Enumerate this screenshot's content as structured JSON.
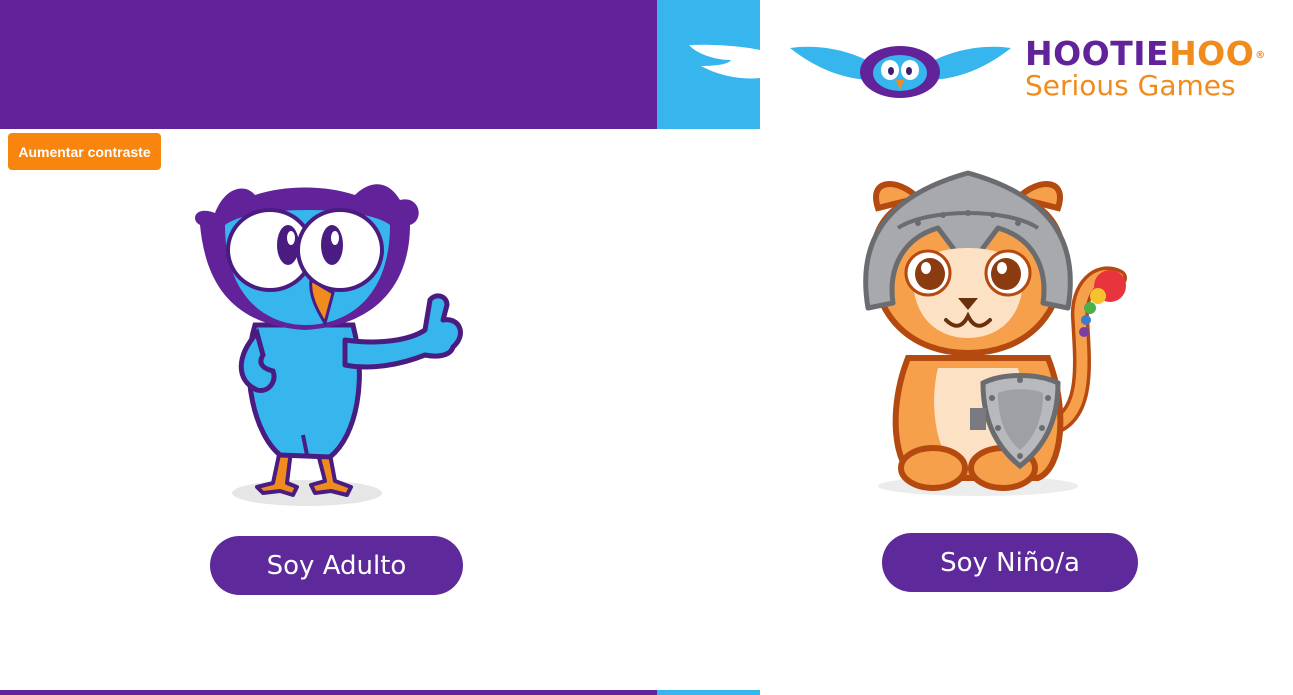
{
  "brand": {
    "name_part1": "HOOTIE",
    "name_part2": "HOO",
    "registered": "®",
    "tagline": "Serious Games"
  },
  "accessibility": {
    "contrast_label": "Aumentar contraste"
  },
  "choices": {
    "adult_label": "Soy Adulto",
    "kid_label": "Soy Niño/a"
  },
  "colors": {
    "purple": "#62239a",
    "blue": "#36b6ec",
    "orange": "#f8850e",
    "button": "#5e2a9b"
  },
  "icons": {
    "logo": "owl-logo-icon",
    "adult_character": "owl-mascot-icon",
    "kid_character": "tiger-mascot-icon"
  }
}
